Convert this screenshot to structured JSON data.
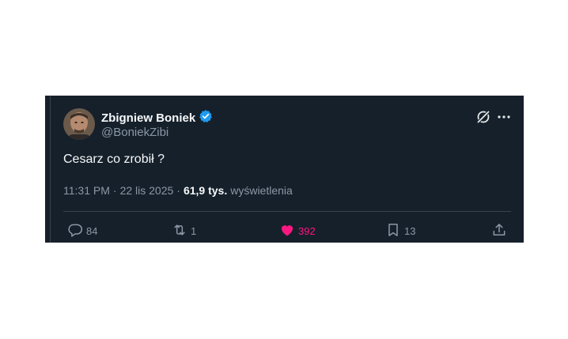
{
  "tweet": {
    "author_name": "Zbigniew Boniek",
    "author_handle": "@BoniekZibi",
    "text": "Cesarz co zrobił ?",
    "time": "11:31 PM",
    "separator1": "·",
    "date": "22 lis 2025",
    "separator2": "·",
    "views_count": "61,9 tys.",
    "views_label": "wyświetlenia"
  },
  "actions": {
    "replies": "84",
    "retweets": "1",
    "likes": "392",
    "bookmarks": "13"
  },
  "icons": {
    "verified": "verified-badge-icon",
    "grok": "grok-icon",
    "more": "more-icon",
    "reply": "reply-icon",
    "retweet": "retweet-icon",
    "like": "heart-icon",
    "bookmark": "bookmark-icon",
    "share": "share-icon"
  },
  "colors": {
    "background": "#15202b",
    "accent_blue": "#1d9bf0",
    "like_pink": "#f91880",
    "text_primary": "#f7f9f9",
    "text_secondary": "#8b98a5"
  }
}
